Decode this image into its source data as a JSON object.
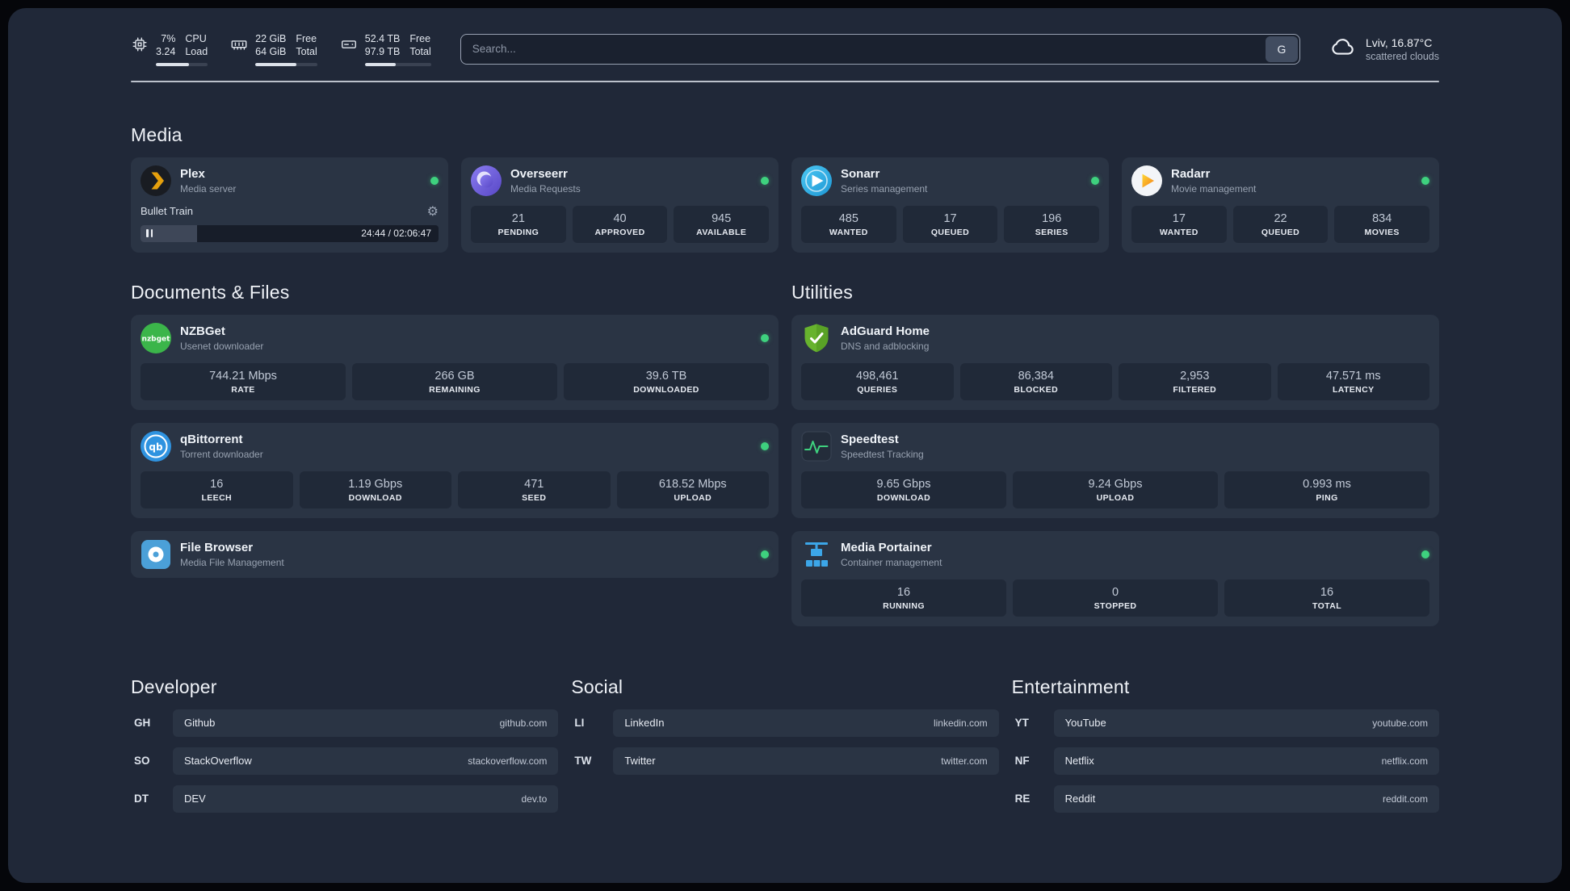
{
  "topbar": {
    "resources": [
      {
        "top_value": "7%",
        "bottom_value": "3.24",
        "top_label": "CPU",
        "bottom_label": "Load",
        "progress_percent": 64
      },
      {
        "top_value": "22 GiB",
        "bottom_value": "64 GiB",
        "top_label": "Free",
        "bottom_label": "Total",
        "progress_percent": 66
      },
      {
        "top_value": "52.4 TB",
        "bottom_value": "97.9 TB",
        "top_label": "Free",
        "bottom_label": "Total",
        "progress_percent": 47
      }
    ],
    "search": {
      "placeholder": "Search...",
      "button_label": "G"
    },
    "weather": {
      "location": "Lviv, 16.87°C",
      "condition": "scattered clouds"
    }
  },
  "sections": {
    "media": {
      "heading": "Media",
      "plex": {
        "title": "Plex",
        "subtitle": "Media server",
        "status": "online",
        "now_playing": "Bullet Train",
        "elapsed_total": "24:44 / 02:06:47",
        "progress_percent": 19
      },
      "overseerr": {
        "title": "Overseerr",
        "subtitle": "Media Requests",
        "status": "online",
        "stats": [
          {
            "value": "21",
            "label": "PENDING"
          },
          {
            "value": "40",
            "label": "APPROVED"
          },
          {
            "value": "945",
            "label": "AVAILABLE"
          }
        ]
      },
      "sonarr": {
        "title": "Sonarr",
        "subtitle": "Series management",
        "status": "online",
        "stats": [
          {
            "value": "485",
            "label": "WANTED"
          },
          {
            "value": "17",
            "label": "QUEUED"
          },
          {
            "value": "196",
            "label": "SERIES"
          }
        ]
      },
      "radarr": {
        "title": "Radarr",
        "subtitle": "Movie management",
        "status": "online",
        "stats": [
          {
            "value": "17",
            "label": "WANTED"
          },
          {
            "value": "22",
            "label": "QUEUED"
          },
          {
            "value": "834",
            "label": "MOVIES"
          }
        ]
      }
    },
    "documents": {
      "heading": "Documents & Files",
      "nzbget": {
        "title": "NZBGet",
        "subtitle": "Usenet downloader",
        "status": "online",
        "stats": [
          {
            "value": "744.21 Mbps",
            "label": "RATE"
          },
          {
            "value": "266 GB",
            "label": "REMAINING"
          },
          {
            "value": "39.6 TB",
            "label": "DOWNLOADED"
          }
        ]
      },
      "qbittorrent": {
        "title": "qBittorrent",
        "subtitle": "Torrent downloader",
        "status": "online",
        "stats": [
          {
            "value": "16",
            "label": "LEECH"
          },
          {
            "value": "1.19 Gbps",
            "label": "DOWNLOAD"
          },
          {
            "value": "471",
            "label": "SEED"
          },
          {
            "value": "618.52 Mbps",
            "label": "UPLOAD"
          }
        ]
      },
      "filebrowser": {
        "title": "File Browser",
        "subtitle": "Media File Management",
        "status": "online"
      }
    },
    "utilities": {
      "heading": "Utilities",
      "adguard": {
        "title": "AdGuard Home",
        "subtitle": "DNS and adblocking",
        "stats": [
          {
            "value": "498,461",
            "label": "QUERIES"
          },
          {
            "value": "86,384",
            "label": "BLOCKED"
          },
          {
            "value": "2,953",
            "label": "FILTERED"
          },
          {
            "value": "47.571 ms",
            "label": "LATENCY"
          }
        ]
      },
      "speedtest": {
        "title": "Speedtest",
        "subtitle": "Speedtest Tracking",
        "stats": [
          {
            "value": "9.65 Gbps",
            "label": "DOWNLOAD"
          },
          {
            "value": "9.24 Gbps",
            "label": "UPLOAD"
          },
          {
            "value": "0.993 ms",
            "label": "PING"
          }
        ]
      },
      "portainer": {
        "title": "Media Portainer",
        "subtitle": "Container management",
        "status": "online",
        "stats": [
          {
            "value": "16",
            "label": "RUNNING"
          },
          {
            "value": "0",
            "label": "STOPPED"
          },
          {
            "value": "16",
            "label": "TOTAL"
          }
        ]
      }
    },
    "bookmarks": [
      {
        "heading": "Developer",
        "items": [
          {
            "abbr": "GH",
            "name": "Github",
            "url": "github.com"
          },
          {
            "abbr": "SO",
            "name": "StackOverflow",
            "url": "stackoverflow.com"
          },
          {
            "abbr": "DT",
            "name": "DEV",
            "url": "dev.to"
          }
        ]
      },
      {
        "heading": "Social",
        "items": [
          {
            "abbr": "LI",
            "name": "LinkedIn",
            "url": "linkedin.com"
          },
          {
            "abbr": "TW",
            "name": "Twitter",
            "url": "twitter.com"
          }
        ]
      },
      {
        "heading": "Entertainment",
        "items": [
          {
            "abbr": "YT",
            "name": "YouTube",
            "url": "youtube.com"
          },
          {
            "abbr": "NF",
            "name": "Netflix",
            "url": "netflix.com"
          },
          {
            "abbr": "RE",
            "name": "Reddit",
            "url": "reddit.com"
          }
        ]
      }
    ]
  },
  "colors": {
    "status_online": "#3ed17e",
    "plex_accent": "#e5a00d"
  }
}
